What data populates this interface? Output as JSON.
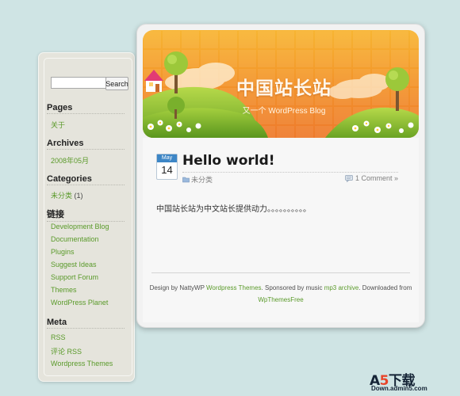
{
  "sidebar": {
    "search": {
      "placeholder": "",
      "button_label": "Search"
    },
    "pages": {
      "title": "Pages",
      "items": [
        "关于"
      ]
    },
    "archives": {
      "title": "Archives",
      "items": [
        "2008年05月"
      ]
    },
    "categories": {
      "title": "Categories",
      "items": [
        {
          "label": "未分类",
          "count": "(1)"
        }
      ]
    },
    "links": {
      "title": "链接",
      "items": [
        "Development Blog",
        "Documentation",
        "Plugins",
        "Suggest Ideas",
        "Support Forum",
        "Themes",
        "WordPress Planet"
      ]
    },
    "meta": {
      "title": "Meta",
      "items": [
        "RSS",
        "评论 RSS",
        "Wordpress Themes"
      ]
    }
  },
  "header": {
    "site_title": "中国站长站",
    "tagline": "又一个 WordPress Blog"
  },
  "post": {
    "month": "May",
    "day": "14",
    "title": "Hello world!",
    "category": "未分类",
    "comments": "1 Comment »",
    "body": "中国站长站为中文站长提供动力。。。。。。。。。。"
  },
  "footer": {
    "prefix": "Design by NattyWP ",
    "link1": "Wordpress Themes",
    "middle": ". Sponsored by music ",
    "link2": "mp3 archive",
    "suffix": ". Downloaded from",
    "link3": "WpThemesFree"
  },
  "watermark": {
    "logo_main": "A",
    "logo_five": "5",
    "logo_rest": "下载",
    "url": "Down.admin5.com"
  },
  "colors": {
    "link_green": "#5a9a2a",
    "header_orange": "#f3952a",
    "date_blue": "#3d86c6",
    "page_background": "#cfe4e4"
  }
}
